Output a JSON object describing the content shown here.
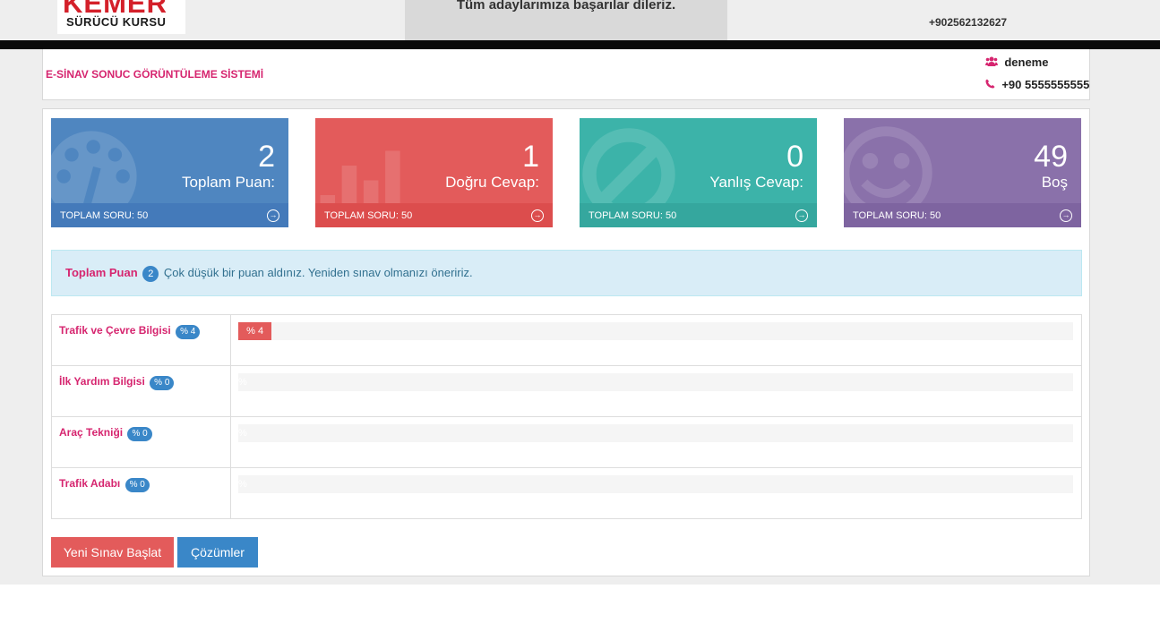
{
  "header": {
    "logo_line1": "KEMER",
    "logo_line2": "SÜRÜCÜ KURSU",
    "announcement": "Tüm adaylarımıza başarılar dileriz.",
    "phone": "+902562132627"
  },
  "info_bar": {
    "system_title": "E-SİNAV SONUC GÖRÜNTÜLEME SİSTEMİ",
    "user_name": "deneme",
    "user_phone": "+90 5555555555",
    "user_icon": "users-icon",
    "phone_icon": "phone-icon"
  },
  "stats": [
    {
      "value": "2",
      "label": "Toplam Puan:",
      "footer": "TOPLAM SORU: 50",
      "color": "#4f86c0",
      "icon": "dashboard-icon"
    },
    {
      "value": "1",
      "label": "Doğru Cevap:",
      "footer": "TOPLAM SORU: 50",
      "color": "#e35b5b",
      "icon": "bar-chart-icon"
    },
    {
      "value": "0",
      "label": "Yanlış Cevap:",
      "footer": "TOPLAM SORU: 50",
      "color": "#3cb3a9",
      "icon": "ban-icon"
    },
    {
      "value": "49",
      "label": "Boş",
      "footer": "TOPLAM SORU: 50",
      "color": "#8a71aa",
      "icon": "smile-icon"
    }
  ],
  "alert": {
    "label": "Toplam Puan",
    "score": "2",
    "message": "Çok düşük bir puan aldınız. Yeniden sınav olmanızı öneririz."
  },
  "categories": [
    {
      "name": "Trafik ve Çevre Bilgisi",
      "badge": "% 4",
      "bar_text": "% 4",
      "percent": 4
    },
    {
      "name": "İlk Yardım Bilgisi",
      "badge": "% 0",
      "bar_text": "%",
      "percent": 0
    },
    {
      "name": "Araç Tekniği",
      "badge": "% 0",
      "bar_text": "%",
      "percent": 0
    },
    {
      "name": "Trafik Adabı",
      "badge": "% 0",
      "bar_text": "%",
      "percent": 0
    }
  ],
  "buttons": {
    "new_exam": "Yeni Sınav Başlat",
    "solutions": "Çözümler"
  }
}
